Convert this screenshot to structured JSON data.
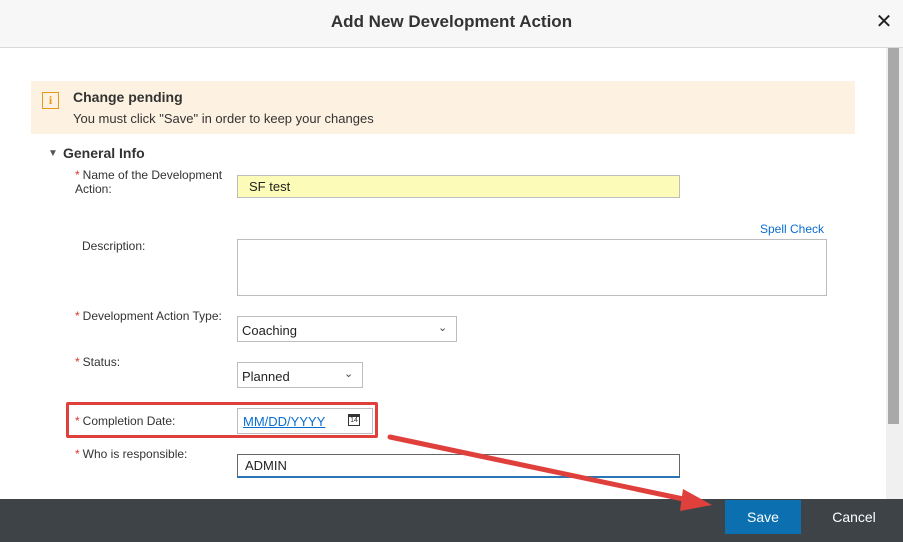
{
  "dialog": {
    "title": "Add New Development Action",
    "close_glyph": "✕"
  },
  "notice": {
    "icon": "info-icon",
    "icon_glyph": "i",
    "title": "Change pending",
    "message": "You must click \"Save\" in order to keep your changes",
    "background": "#fdf2e1"
  },
  "section": {
    "toggle_glyph": "▼",
    "title": "General Info"
  },
  "fields": {
    "required_marker": "*",
    "name_label": "Name of the Development Action:",
    "name_value": "SF test",
    "description_label": "Description:",
    "description_value": "",
    "spell_check": "Spell Check",
    "type_label": "Development Action Type:",
    "type_value": "Coaching",
    "status_label": "Status:",
    "status_value": "Planned",
    "completion_label": "Completion Date:",
    "completion_placeholder": "MM/DD/YYYY",
    "calendar_icon": "calendar-icon",
    "calendar_glyph": "14",
    "who_label": "Who is responsible:",
    "who_value": "ADMIN"
  },
  "footer": {
    "save_label": "Save",
    "cancel_label": "Cancel"
  },
  "colors": {
    "accent": "#0b6fb0",
    "required": "#d9342b",
    "annotation": "#e0403c",
    "footer_bg": "#3d4347",
    "highlight_input": "#fcfbb7"
  },
  "icons": {
    "chevron": "chevron-down-icon",
    "chevron_glyph": "⌄"
  }
}
